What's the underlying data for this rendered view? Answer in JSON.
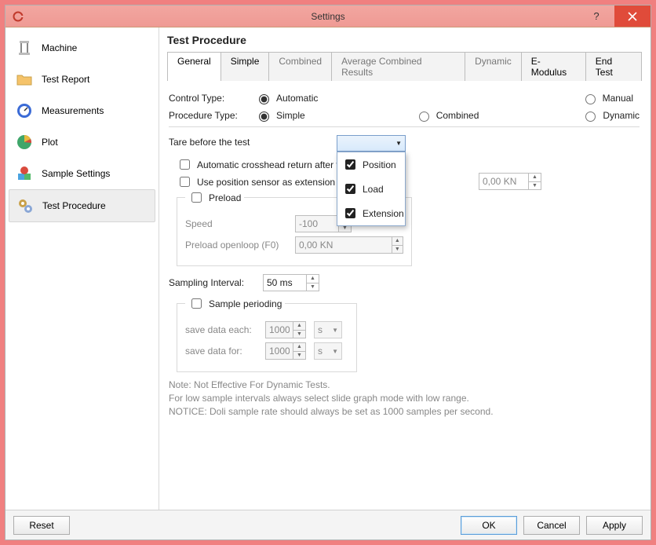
{
  "title": "Settings",
  "sidebar": {
    "items": [
      {
        "label": "Machine"
      },
      {
        "label": "Test Report"
      },
      {
        "label": "Measurements"
      },
      {
        "label": "Plot"
      },
      {
        "label": "Sample Settings"
      },
      {
        "label": "Test Procedure"
      }
    ]
  },
  "main": {
    "heading": "Test Procedure",
    "tabs": [
      {
        "label": "General",
        "active": true
      },
      {
        "label": "Simple",
        "enabled": true
      },
      {
        "label": "Combined"
      },
      {
        "label": "Average Combined Results"
      },
      {
        "label": "Dynamic"
      },
      {
        "label": "E-Modulus",
        "enabled": true
      },
      {
        "label": "End Test",
        "enabled": true
      }
    ],
    "control_type_label": "Control Type:",
    "control_type": {
      "automatic": "Automatic",
      "manual": "Manual",
      "value": "Automatic"
    },
    "procedure_type_label": "Procedure Type:",
    "procedure_type": {
      "simple": "Simple",
      "combined": "Combined",
      "dynamic": "Dynamic",
      "value": "Simple"
    },
    "tare_label": "Tare before the test",
    "tare_dropdown": {
      "position": "Position",
      "load": "Load",
      "extension": "Extension",
      "position_checked": true,
      "load_checked": true,
      "extension_checked": true
    },
    "chk_return": "Automatic crosshead return after the t",
    "chk_use_ext": "Use position sensor as extension after:",
    "right_value": "0,00 KN",
    "preload": {
      "title": "Preload",
      "speed_label": "Speed",
      "speed": "-100",
      "openloop_label": "Preload openloop (F0)",
      "openloop": "0,00 KN"
    },
    "sampling_interval_label": "Sampling Interval:",
    "sampling_interval": "50 ms",
    "sample_perioding": {
      "title": "Sample perioding",
      "each_label": "save data each:",
      "each_value": "1000",
      "each_unit": "s",
      "for_label": "save data for:",
      "for_value": "1000",
      "for_unit": "s"
    },
    "notes": {
      "l1": "Note: Not Effective For Dynamic Tests.",
      "l2": "For low sample intervals always select slide graph mode with low range.",
      "l3": "NOTICE: Doli sample rate should always be set as 1000 samples per second."
    }
  },
  "footer": {
    "reset": "Reset",
    "ok": "OK",
    "cancel": "Cancel",
    "apply": "Apply"
  }
}
